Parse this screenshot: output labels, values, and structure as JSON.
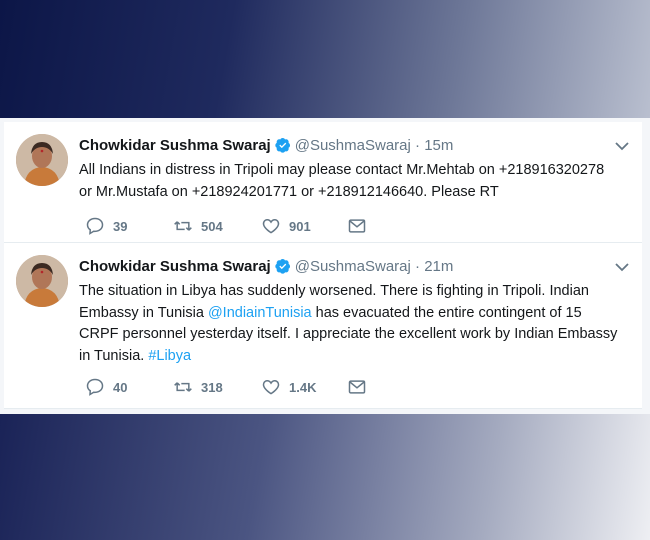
{
  "tweets": [
    {
      "name": "Chowkidar Sushma Swaraj",
      "handle": "@SushmaSwaraj",
      "dot": "·",
      "time": "15m",
      "text_lines": [
        "All Indians in distress in Tripoli may please contact Mr.Mehtab on +218916320278",
        "or Mr.Mustafa on +218924201771 or +218912146640. Please RT"
      ],
      "replies": "39",
      "retweets": "504",
      "likes": "901"
    },
    {
      "name": "Chowkidar Sushma Swaraj",
      "handle": "@SushmaSwaraj",
      "dot": "·",
      "time": "21m",
      "line1": "The situation in Libya has suddenly worsened. There is fighting in Tripoli. Indian",
      "line2_pre": "Embassy in Tunisia ",
      "line2_mention": "@IndiainTunisia",
      "line2_post": " has evacuated the entire contingent of 15",
      "line3": "CRPF personnel yesterday itself. I appreciate the excellent work by Indian Embassy",
      "line4_pre": "in Tunisia. ",
      "line4_hashtag": "#Libya",
      "replies": "40",
      "retweets": "318",
      "likes": "1.4K"
    }
  ],
  "icons": {
    "verified": "verified-badge-icon",
    "chevron": "chevron-down-icon",
    "reply": "reply-icon",
    "retweet": "retweet-icon",
    "like": "heart-icon",
    "dm": "envelope-icon"
  },
  "colors": {
    "link": "#1da1f2",
    "meta": "#657786",
    "text": "#14171a"
  }
}
